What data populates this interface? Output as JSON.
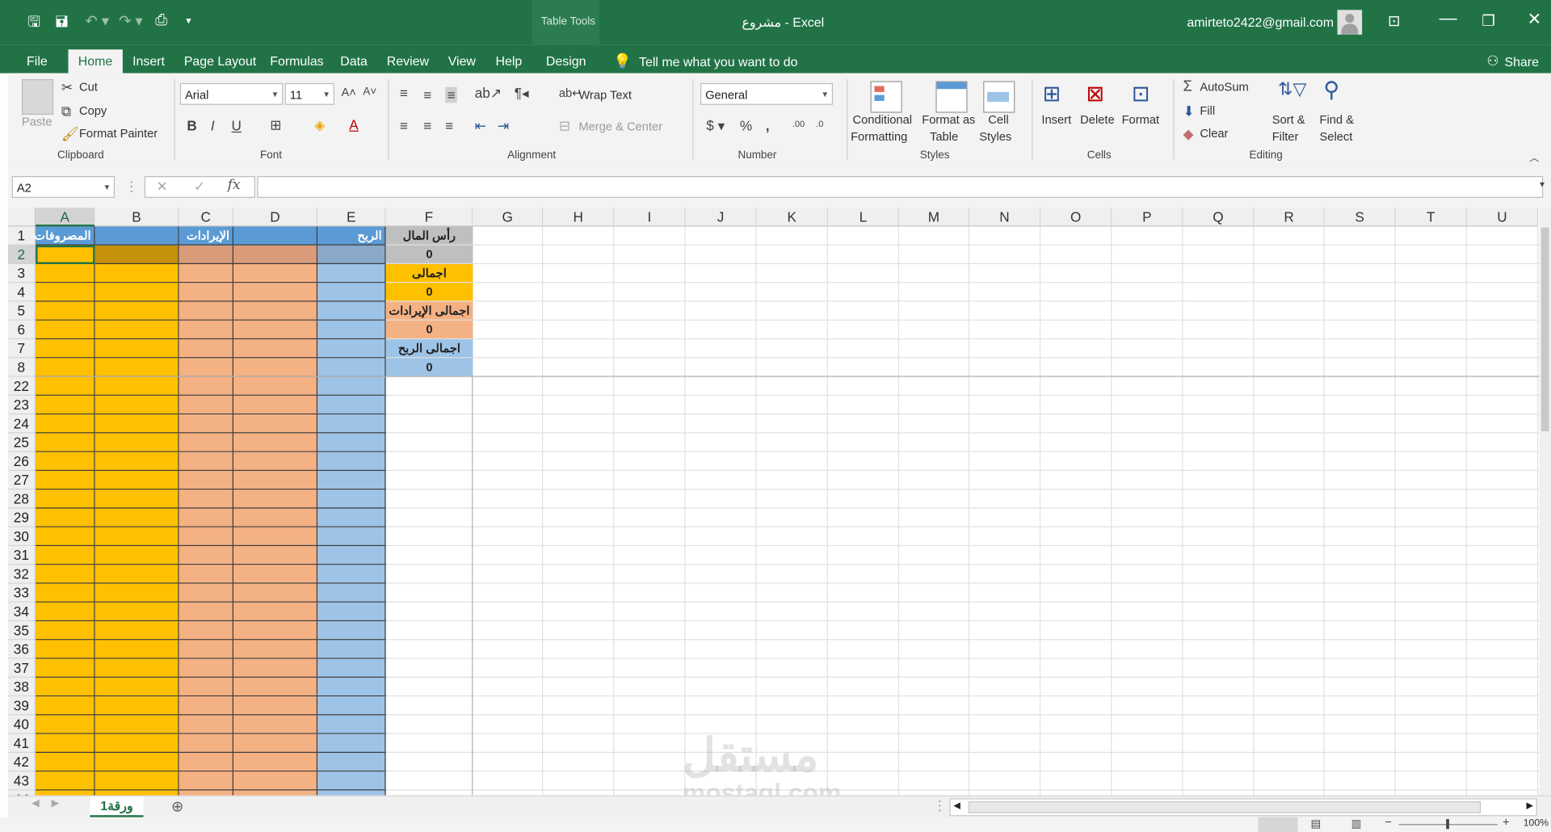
{
  "titlebar": {
    "context_tab": "Table Tools",
    "doc_title": "مشروع  -  Excel",
    "account": "amirteto2422@gmail.com"
  },
  "tabs": [
    "File",
    "Home",
    "Insert",
    "Page Layout",
    "Formulas",
    "Data",
    "Review",
    "View",
    "Help",
    "Design"
  ],
  "tell_me": "Tell me what you want to do",
  "share": "Share",
  "ribbon": {
    "clipboard": {
      "paste": "Paste",
      "cut": "Cut",
      "copy": "Copy",
      "format_painter": "Format Painter",
      "label": "Clipboard"
    },
    "font": {
      "name": "Arial",
      "size": "11",
      "label": "Font"
    },
    "alignment": {
      "wrap": "Wrap Text",
      "merge": "Merge & Center",
      "label": "Alignment"
    },
    "number": {
      "format": "General",
      "label": "Number"
    },
    "styles": {
      "conditional": "Conditional",
      "conditional2": "Formatting",
      "format_as": "Format as",
      "format_as2": "Table",
      "cell": "Cell",
      "cell2": "Styles",
      "label": "Styles"
    },
    "cells": {
      "insert": "Insert",
      "delete": "Delete",
      "format": "Format",
      "label": "Cells"
    },
    "editing": {
      "autosum": "AutoSum",
      "fill": "Fill",
      "clear": "Clear",
      "sort": "Sort &",
      "sort2": "Filter",
      "find": "Find &",
      "find2": "Select",
      "label": "Editing"
    }
  },
  "formula_bar": {
    "name_box": "A2",
    "fx": "fx",
    "content": ""
  },
  "columns": [
    "A",
    "B",
    "C",
    "D",
    "E",
    "F",
    "G",
    "H",
    "I",
    "J",
    "K",
    "L",
    "M",
    "N",
    "O",
    "P",
    "Q",
    "R",
    "S",
    "T",
    "U"
  ],
  "rows": [
    "1",
    "2",
    "3",
    "4",
    "5",
    "6",
    "7",
    "8",
    "22",
    "23",
    "24",
    "25",
    "26",
    "27",
    "28",
    "29",
    "30",
    "31",
    "32",
    "33",
    "34",
    "35",
    "36",
    "37",
    "38",
    "39",
    "40",
    "41",
    "42",
    "43",
    "44"
  ],
  "table_headers": {
    "A": "المصروفات",
    "C": "الإيرادات",
    "E": "الربح"
  },
  "summary": {
    "capital_label": "رأس المال",
    "capital_value": "0",
    "expenses_label": "اجمالى المصروفات",
    "expenses_value": "0",
    "revenues_label": "اجمالى الإيرادات",
    "revenues_value": "0",
    "profit_label": "اجمالى الربح",
    "profit_value": "0"
  },
  "sheet_tab": "ورقة1",
  "zoom": "100%",
  "watermark": {
    "arabic": "مستقل",
    "latin": "mostaql.com"
  }
}
